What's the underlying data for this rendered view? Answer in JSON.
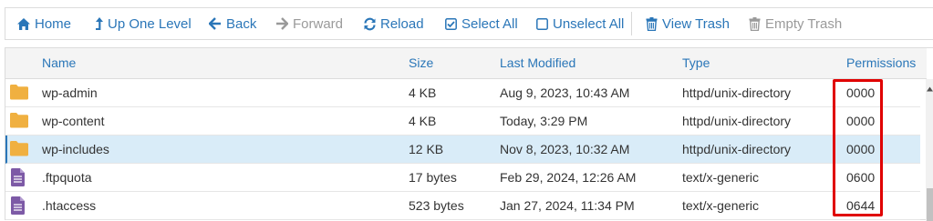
{
  "toolbar": {
    "home": "Home",
    "up_one_level": "Up One Level",
    "back": "Back",
    "forward": "Forward",
    "reload": "Reload",
    "select_all": "Select All",
    "unselect_all": "Unselect All",
    "view_trash": "View Trash",
    "empty_trash": "Empty Trash"
  },
  "columns": {
    "name": "Name",
    "size": "Size",
    "last_modified": "Last Modified",
    "type": "Type",
    "permissions": "Permissions"
  },
  "files": [
    {
      "name": "wp-admin",
      "size": "4 KB",
      "modified": "Aug 9, 2023, 10:43 AM",
      "type": "httpd/unix-directory",
      "permissions": "0000",
      "icon": "folder-icon"
    },
    {
      "name": "wp-content",
      "size": "4 KB",
      "modified": "Today, 3:29 PM",
      "type": "httpd/unix-directory",
      "permissions": "0000",
      "icon": "folder-icon"
    },
    {
      "name": "wp-includes",
      "size": "12 KB",
      "modified": "Nov 8, 2023, 10:32 AM",
      "type": "httpd/unix-directory",
      "permissions": "0000",
      "icon": "folder-icon",
      "selected": true
    },
    {
      "name": ".ftpquota",
      "size": "17 bytes",
      "modified": "Feb 29, 2024, 12:26 AM",
      "type": "text/x-generic",
      "permissions": "0600",
      "icon": "file-icon"
    },
    {
      "name": ".htaccess",
      "size": "523 bytes",
      "modified": "Jan 27, 2024, 11:34 PM",
      "type": "text/x-generic",
      "permissions": "0644",
      "icon": "file-icon"
    }
  ],
  "colors": {
    "link": "#2a76b8",
    "disabled": "#9a9a9a",
    "folder": "#f0b040",
    "file": "#7d5aa6",
    "selected_row": "#d9ecf8",
    "highlight": "#e00000"
  }
}
